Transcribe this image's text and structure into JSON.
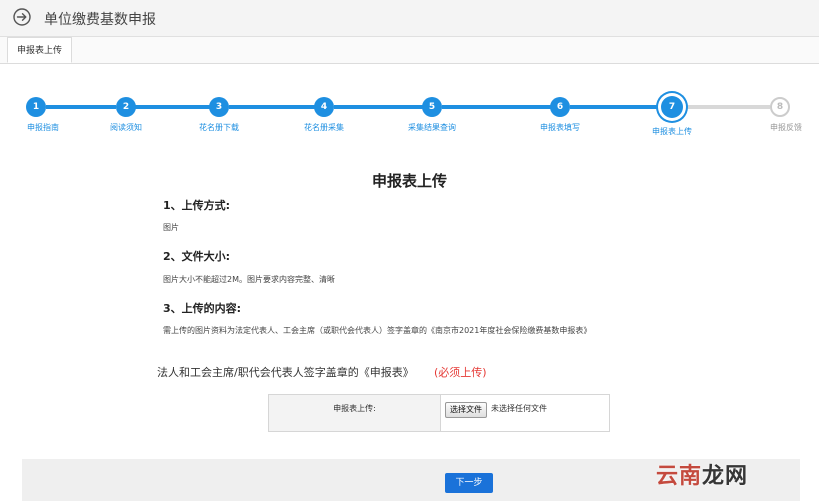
{
  "header": {
    "title": "单位缴费基数申报"
  },
  "tabs": [
    {
      "label": "申报表上传"
    }
  ],
  "steps": [
    {
      "number": "1",
      "label": "申报指南",
      "status": "done"
    },
    {
      "number": "2",
      "label": "阅读须知",
      "status": "done"
    },
    {
      "number": "3",
      "label": "花名册下载",
      "status": "done"
    },
    {
      "number": "4",
      "label": "花名册采集",
      "status": "done"
    },
    {
      "number": "5",
      "label": "采集结果查询",
      "status": "done"
    },
    {
      "number": "6",
      "label": "申报表填写",
      "status": "done"
    },
    {
      "number": "7",
      "label": "申报表上传",
      "status": "current"
    },
    {
      "number": "8",
      "label": "申报反馈",
      "status": "pending"
    }
  ],
  "main": {
    "title": "申报表上传",
    "sections": [
      {
        "heading": "1、上传方式:",
        "text": "图片"
      },
      {
        "heading": "2、文件大小:",
        "text": "图片大小不能超过2M。图片要求内容完整、清晰"
      },
      {
        "heading": "3、上传的内容:",
        "text": "需上传的图片资料为法定代表人、工会主席（或职代会代表人）签字盖章的《南京市2021年度社会保险缴费基数申报表》"
      }
    ],
    "requirement_label": "法人和工会主席/职代会代表人签字盖章的《申报表》",
    "requirement_flag": "(必须上传)"
  },
  "upload": {
    "label": "申报表上传:",
    "button_label": "选择文件",
    "file_status": "未选择任何文件"
  },
  "footer": {
    "next_label": "下一步"
  },
  "watermark": {
    "text_red": "云南",
    "text_dark": "龙网"
  },
  "colors": {
    "accent": "#1e8fe1",
    "button": "#1a72d9",
    "required": "#e53935"
  }
}
